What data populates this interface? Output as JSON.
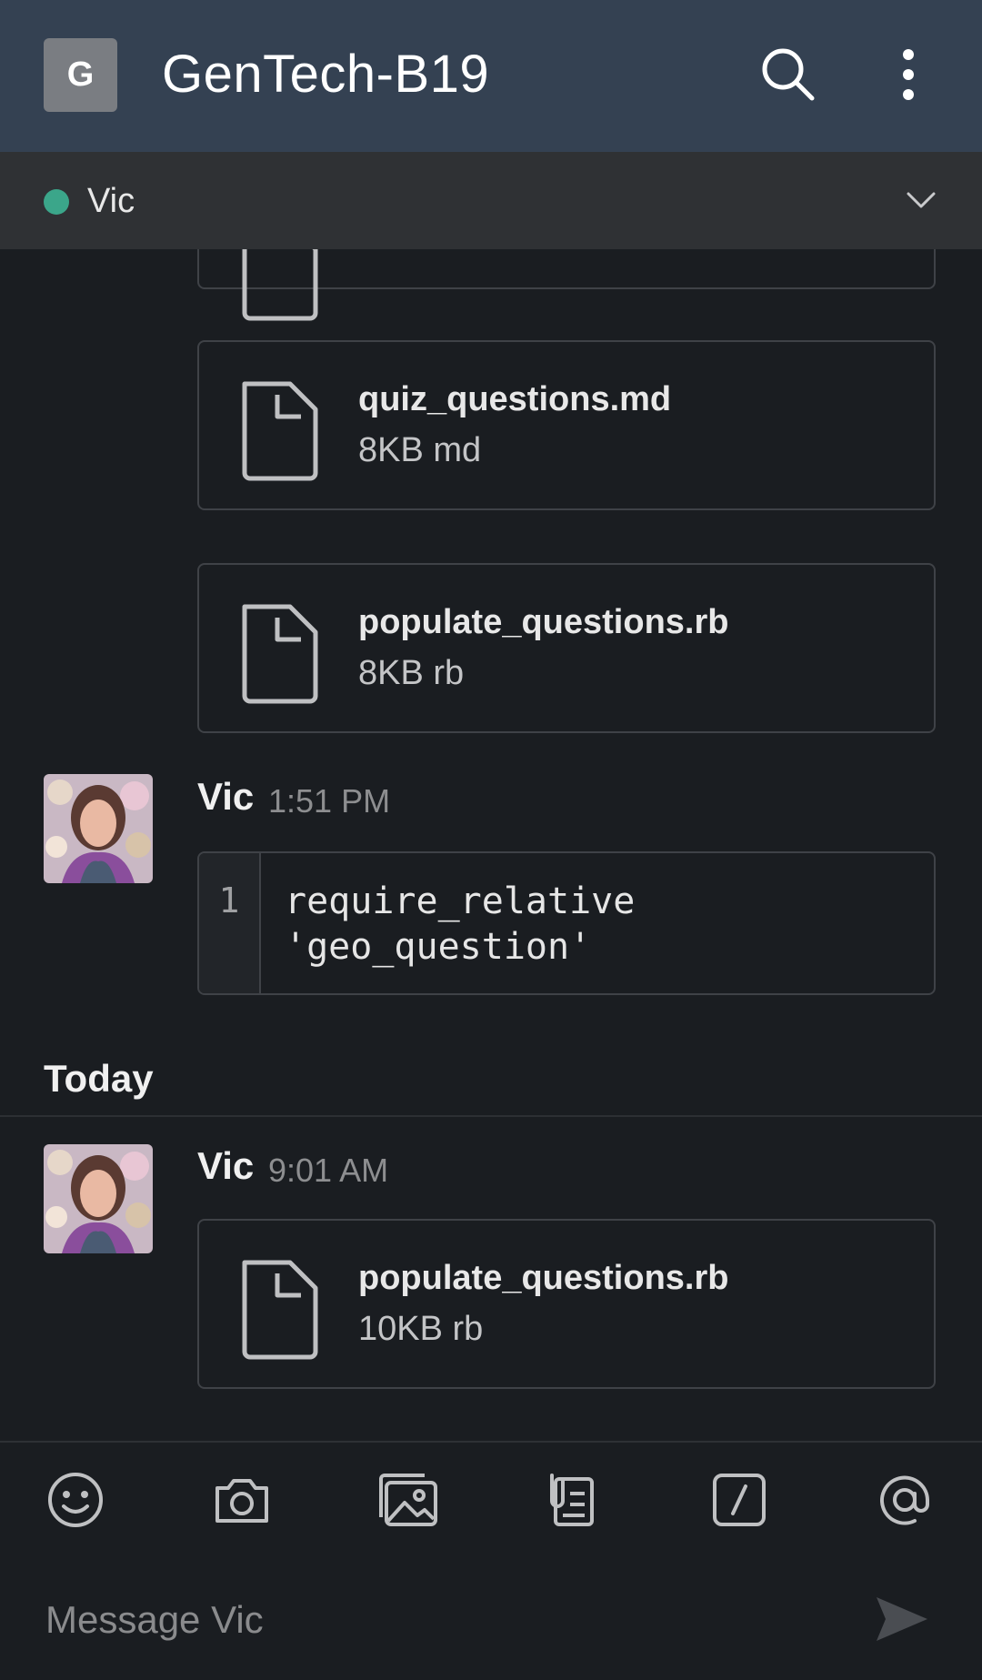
{
  "header": {
    "workspace_initial": "G",
    "workspace_name": "GenTech-B19",
    "icons": [
      "search-icon",
      "more-vertical-icon"
    ]
  },
  "channel_bar": {
    "name": "Vic",
    "presence": "active",
    "presence_color": "#3ba68a"
  },
  "messages": {
    "files_earlier": [
      {
        "name": "quiz_questions.md",
        "meta": "8KB md"
      },
      {
        "name": "populate_questions.rb",
        "meta": "8KB rb"
      }
    ],
    "code_message": {
      "author": "Vic",
      "time": "1:51 PM",
      "line_number": "1",
      "code": "require_relative\n'geo_question'"
    },
    "day_divider": "Today",
    "today_message": {
      "author": "Vic",
      "time": "9:01 AM",
      "file": {
        "name": "populate_questions.rb",
        "meta": "10KB rb"
      }
    }
  },
  "composer": {
    "placeholder": "Message Vic",
    "tools": [
      "emoji-icon",
      "camera-icon",
      "image-gallery-icon",
      "clip-icon",
      "slash-command-icon",
      "at-mention-icon"
    ],
    "send_icon": "send-icon"
  },
  "colors": {
    "header_bg": "#344152",
    "channel_bar_bg": "#2f3134",
    "body_bg": "#1a1d21",
    "border": "#3f4247"
  }
}
